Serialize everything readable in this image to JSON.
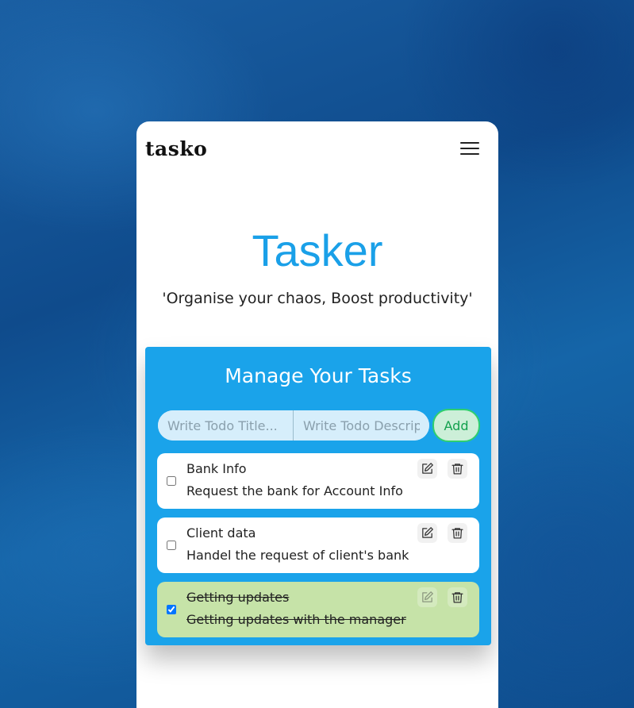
{
  "app": {
    "logo": "tasko",
    "menu_icon": "hamburger-menu-icon"
  },
  "hero": {
    "title": "Tasker",
    "subtitle": "'Organise your chaos, Boost productivity'"
  },
  "panel": {
    "title": "Manage Your Tasks",
    "title_input_placeholder": "Write Todo Title...",
    "description_input_placeholder": "Write Todo Description...",
    "add_label": "Add",
    "colors": {
      "panel_bg": "#1aa3ea",
      "hero_title": "#1aa0e8",
      "completed_bg": "#c6e3a8",
      "add_border": "#2fcf6f"
    }
  },
  "todos": [
    {
      "title": "Bank Info",
      "description": "Request the bank for Account Info",
      "completed": false,
      "edit_icon": "pencil-icon",
      "delete_icon": "trash-icon"
    },
    {
      "title": "Client data",
      "description": "Handel the request of client's bank",
      "completed": false,
      "edit_icon": "pencil-icon",
      "delete_icon": "trash-icon"
    },
    {
      "title": "Getting updates",
      "description": "Getting updates with the manager",
      "completed": true,
      "edit_icon": "pencil-icon",
      "delete_icon": "trash-icon"
    }
  ]
}
